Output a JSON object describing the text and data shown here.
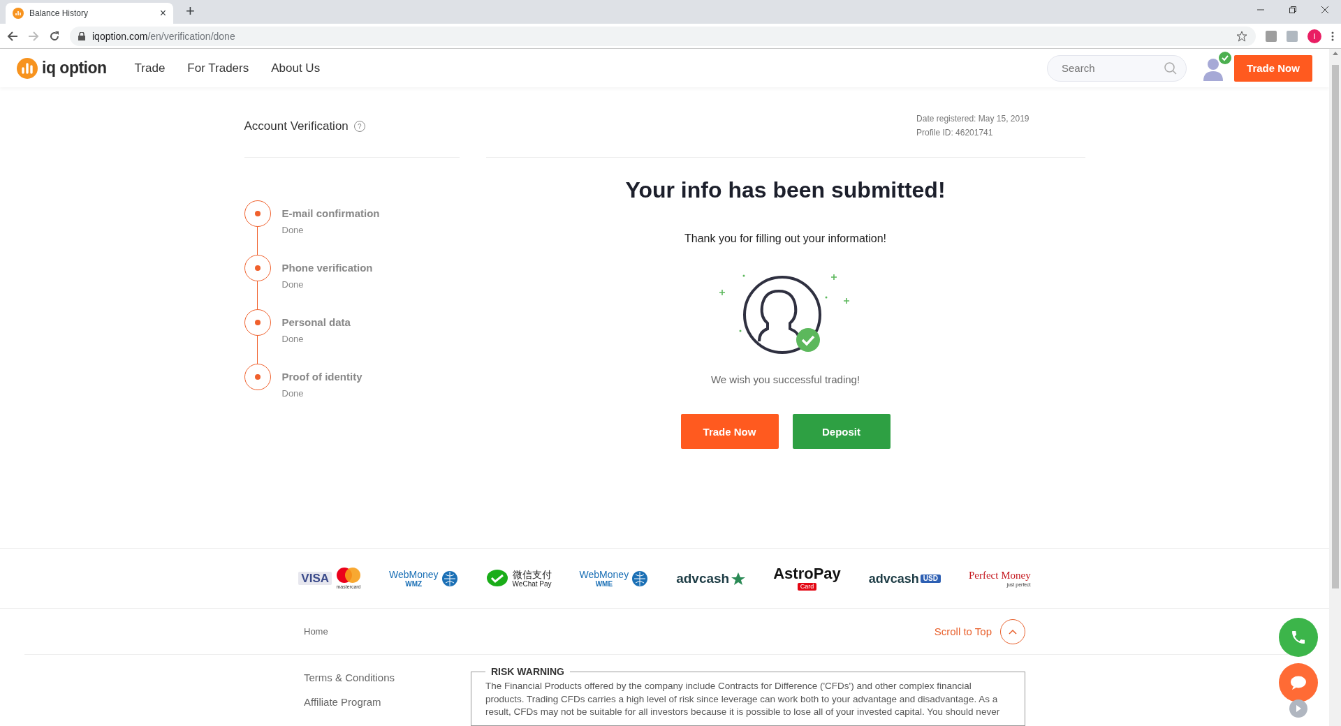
{
  "browser": {
    "tab": {
      "title": "Balance History",
      "close": "×"
    },
    "new_tab": "+",
    "url_host": "iqoption.com",
    "url_path": "/en/verification/done",
    "profile_initial": "I"
  },
  "header": {
    "logo": "iq option",
    "nav": [
      {
        "label": "Trade"
      },
      {
        "label": "For Traders"
      },
      {
        "label": "About Us"
      }
    ],
    "search": {
      "placeholder": "Search"
    },
    "trade_button": "Trade Now"
  },
  "verification": {
    "title": "Account Verification",
    "help": "?",
    "date_registered": "Date registered: May 15, 2019",
    "profile_id": "Profile ID: 46201741",
    "steps": [
      {
        "title": "E-mail confirmation",
        "status": "Done"
      },
      {
        "title": "Phone verification",
        "status": "Done"
      },
      {
        "title": "Personal data",
        "status": "Done"
      },
      {
        "title": "Proof of identity",
        "status": "Done"
      }
    ],
    "heading": "Your info has been submitted!",
    "subtitle": "Thank you for filling out your information!",
    "wish": "We wish you successful trading!",
    "buttons": [
      {
        "label": "Trade Now",
        "kind": "primary"
      },
      {
        "label": "Deposit",
        "kind": "success"
      }
    ]
  },
  "payments": [
    {
      "kind": "card",
      "lines": [
        "VISA",
        "mastercard"
      ]
    },
    {
      "kind": "webmoney",
      "lines": [
        "WebMoney",
        "WMZ"
      ]
    },
    {
      "kind": "wechat",
      "lines": [
        "微信支付",
        "WeChat Pay"
      ]
    },
    {
      "kind": "webmoney",
      "lines": [
        "WebMoney",
        "WME"
      ]
    },
    {
      "kind": "advcash",
      "lines": [
        "advcash"
      ]
    },
    {
      "kind": "astropay",
      "lines": [
        "AstroPay",
        "Card"
      ]
    },
    {
      "kind": "advcash_usd",
      "lines": [
        "advcash",
        "USD"
      ]
    },
    {
      "kind": "perfect",
      "lines": [
        "Perfect Money",
        "just perfect"
      ]
    }
  ],
  "footer": {
    "breadcrumb": "Home",
    "scroll_top": "Scroll to Top",
    "links": [
      "Terms & Conditions",
      "Affiliate Program"
    ],
    "risk_title": "RISK WARNING",
    "risk_text": "The Financial Products offered by the company include Contracts for Difference ('CFDs') and other complex financial products. Trading CFDs carries a high level of risk since leverage can work both to your advantage and disadvantage. As a result, CFDs may not be suitable for all investors because it is possible to lose all of your invested capital. You should never"
  }
}
